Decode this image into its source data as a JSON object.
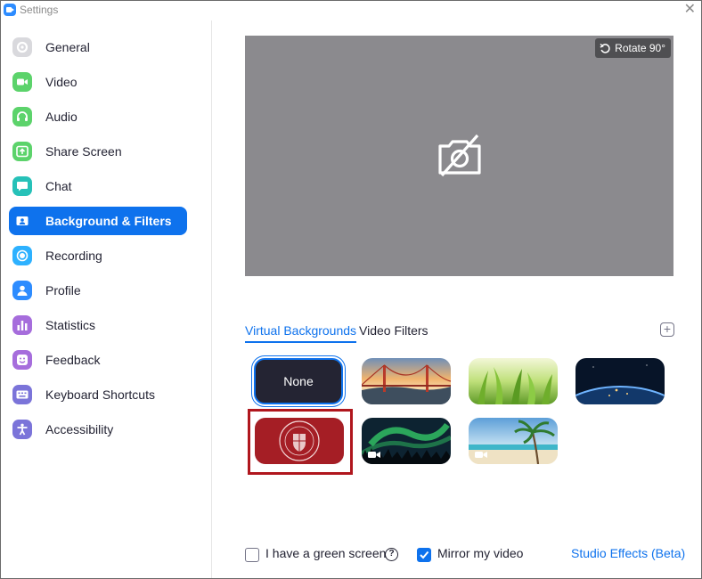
{
  "window": {
    "title": "Settings"
  },
  "colors": {
    "accent": "#0e72ed",
    "highlight": "#b0161d",
    "preview_bg": "#8b8a8e"
  },
  "sidebar": {
    "items": [
      {
        "label": "General",
        "icon": "gear-icon",
        "color": "#e6e6e6",
        "active": false
      },
      {
        "label": "Video",
        "icon": "video-camera-icon",
        "color": "#5cd36b",
        "active": false
      },
      {
        "label": "Audio",
        "icon": "headphones-icon",
        "color": "#5cd36b",
        "active": false
      },
      {
        "label": "Share Screen",
        "icon": "share-screen-icon",
        "color": "#5cd36b",
        "active": false
      },
      {
        "label": "Chat",
        "icon": "chat-icon",
        "color": "#26c1b8",
        "active": false
      },
      {
        "label": "Background & Filters",
        "icon": "person-card-icon",
        "color": "#0e72ed",
        "active": true
      },
      {
        "label": "Recording",
        "icon": "record-icon",
        "color": "#2db1ff",
        "active": false
      },
      {
        "label": "Profile",
        "icon": "profile-icon",
        "color": "#2d8cff",
        "active": false
      },
      {
        "label": "Statistics",
        "icon": "bar-chart-icon",
        "color": "#a66ddc",
        "active": false
      },
      {
        "label": "Feedback",
        "icon": "smiley-icon",
        "color": "#a66ddc",
        "active": false
      },
      {
        "label": "Keyboard Shortcuts",
        "icon": "keyboard-icon",
        "color": "#7b74d9",
        "active": false
      },
      {
        "label": "Accessibility",
        "icon": "accessibility-icon",
        "color": "#7b74d9",
        "active": false
      }
    ]
  },
  "preview": {
    "rotate_label": "Rotate 90°",
    "icon": "camera-off-icon"
  },
  "tabs": [
    {
      "label": "Virtual Backgrounds",
      "active": true
    },
    {
      "label": "Video Filters",
      "active": false
    }
  ],
  "add_icon": "plus-icon",
  "backgrounds": [
    {
      "label": "None",
      "kind": "none",
      "selected": true
    },
    {
      "kind": "golden-gate",
      "selected": false
    },
    {
      "kind": "grass",
      "selected": false
    },
    {
      "kind": "earth",
      "selected": false
    },
    {
      "kind": "university-seal",
      "selected": false,
      "highlighted": true
    },
    {
      "kind": "aurora",
      "selected": false,
      "video": true
    },
    {
      "kind": "beach",
      "selected": false,
      "video": true
    }
  ],
  "footer": {
    "green_screen_label": "I have a green screen",
    "green_screen_checked": false,
    "mirror_label": "Mirror my video",
    "mirror_checked": true,
    "studio_effects_label": "Studio Effects (Beta)"
  }
}
